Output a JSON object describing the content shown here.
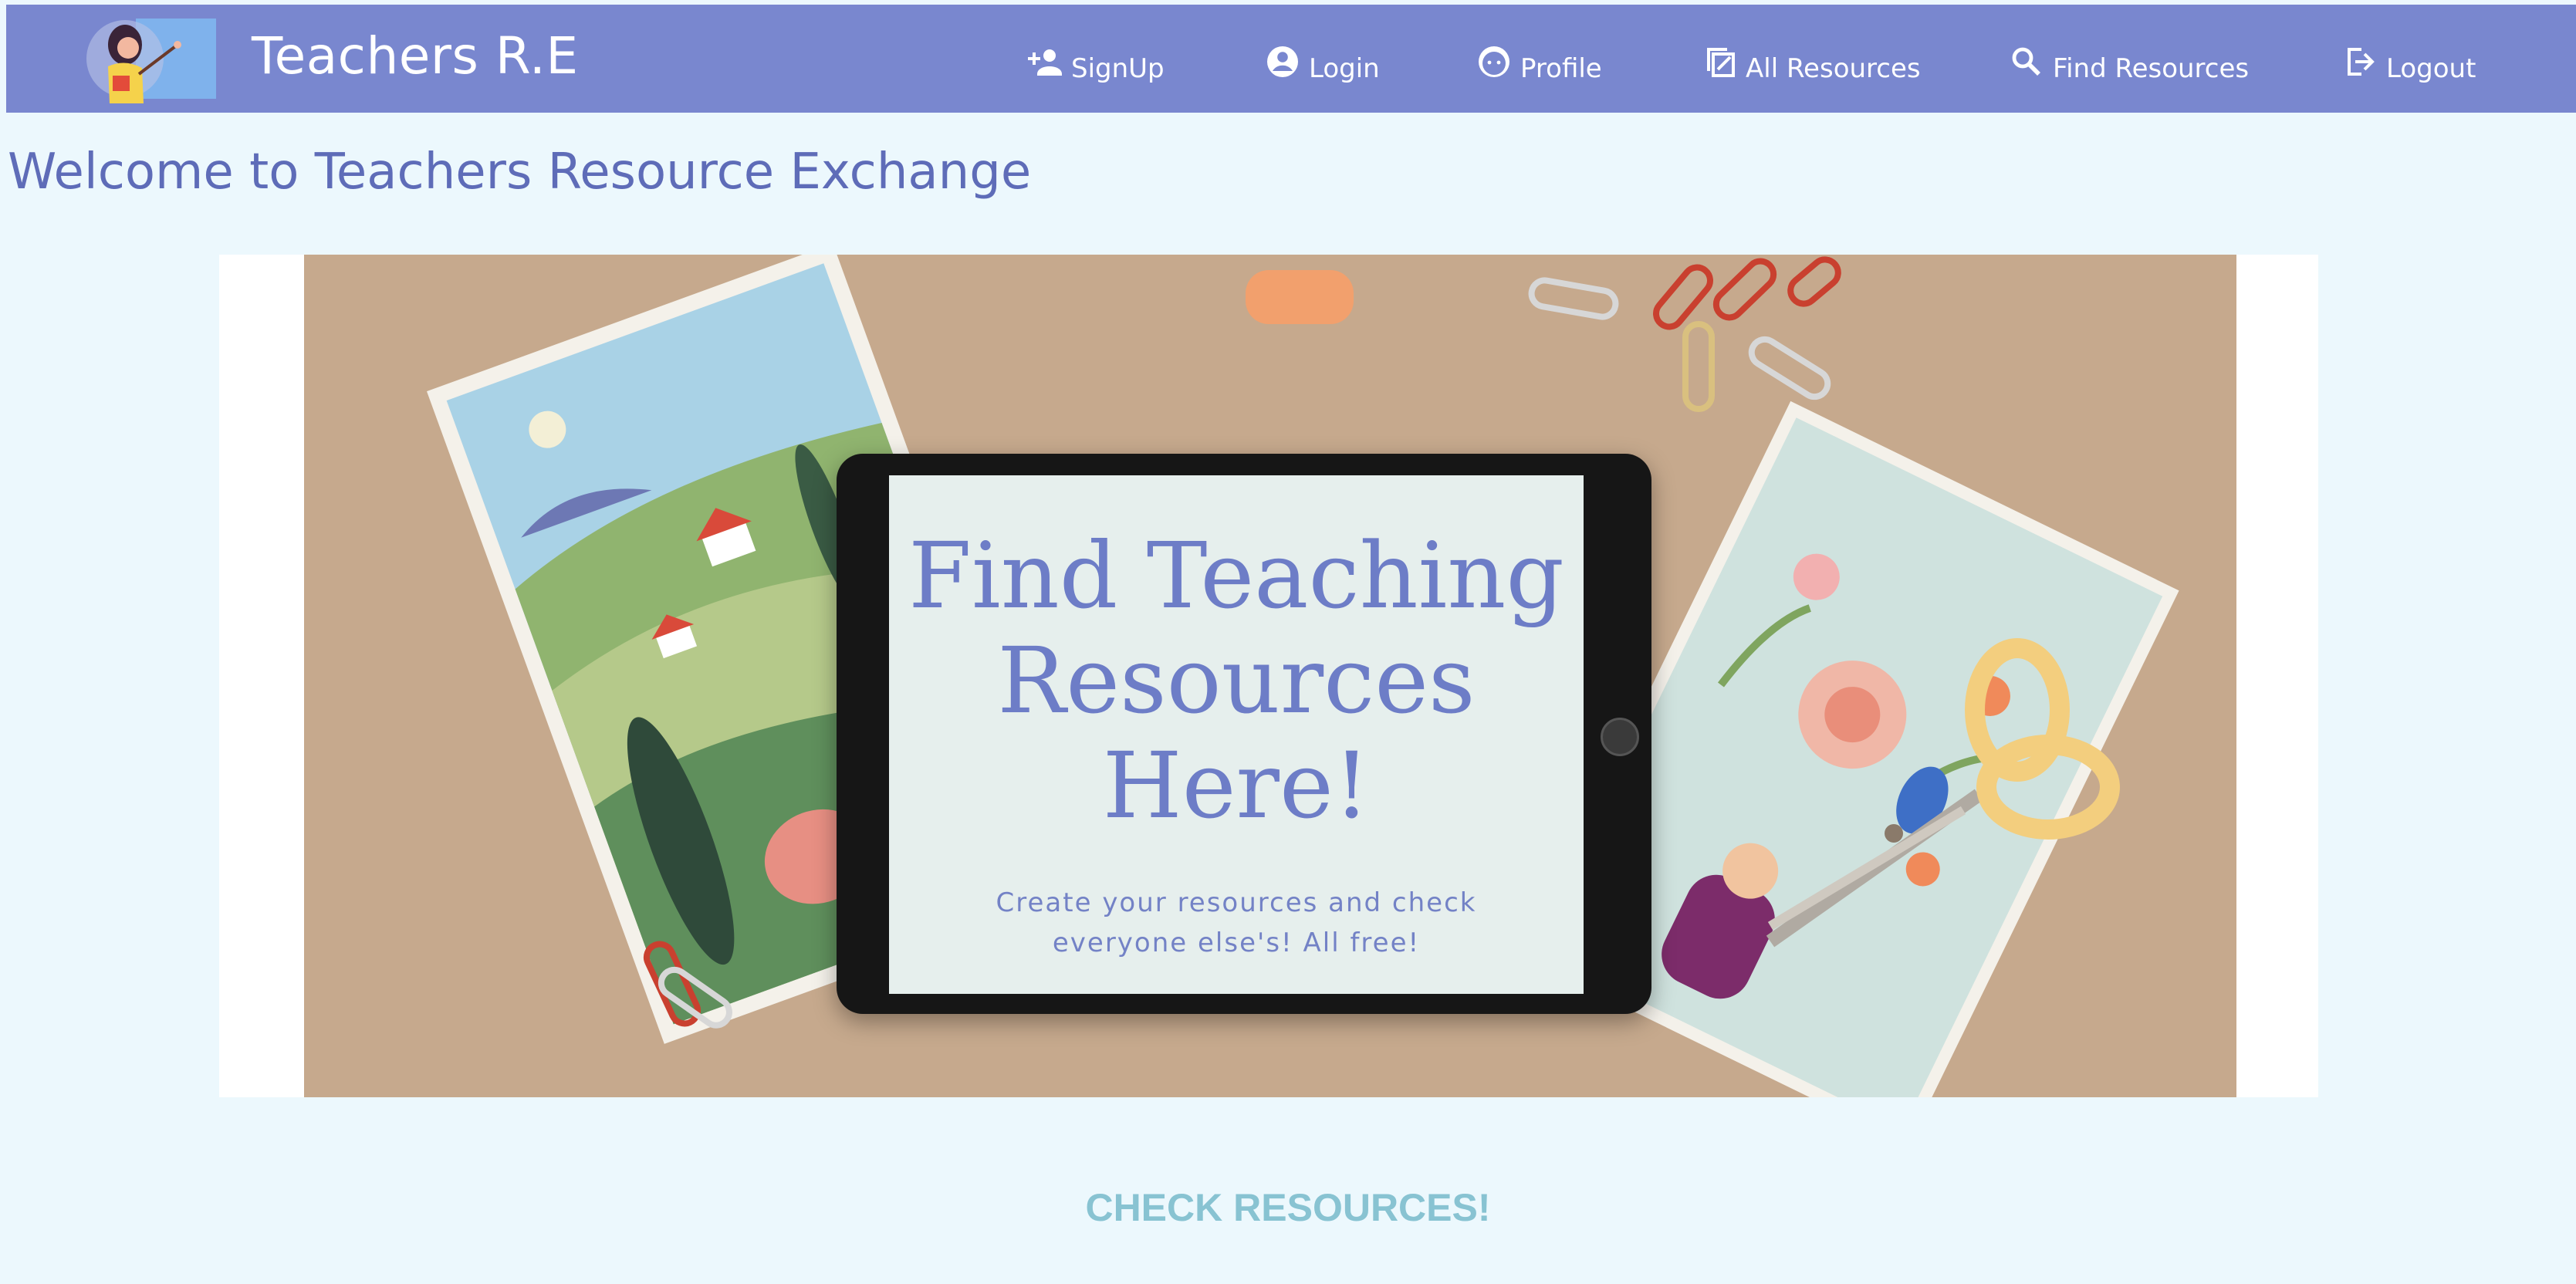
{
  "brand": {
    "name": "Teachers R.E"
  },
  "nav": {
    "signup": "SignUp",
    "login": "Login",
    "profile": "Profile",
    "all_resources": "All Resources",
    "find_resources": "Find Resources",
    "logout": "Logout"
  },
  "page": {
    "title": "Welcome to Teachers Resource Exchange"
  },
  "hero": {
    "headline_line1": "Find Teaching",
    "headline_line2": "Resources",
    "headline_line3": "Here!",
    "subtext_line1": "Create your resources and check",
    "subtext_line2": "everyone else's! All free!"
  },
  "cta": {
    "label": "CHECK RESOURCES!"
  },
  "colors": {
    "navbar": "#7987cf",
    "page_bg": "#ecf8fd",
    "title": "#5e6cb8",
    "cta": "#88c3d2"
  },
  "icons": {
    "signup": "person-add-icon",
    "login": "account-circle-icon",
    "profile": "face-icon",
    "all_resources": "resources-icon",
    "find_resources": "search-icon",
    "logout": "logout-icon"
  }
}
